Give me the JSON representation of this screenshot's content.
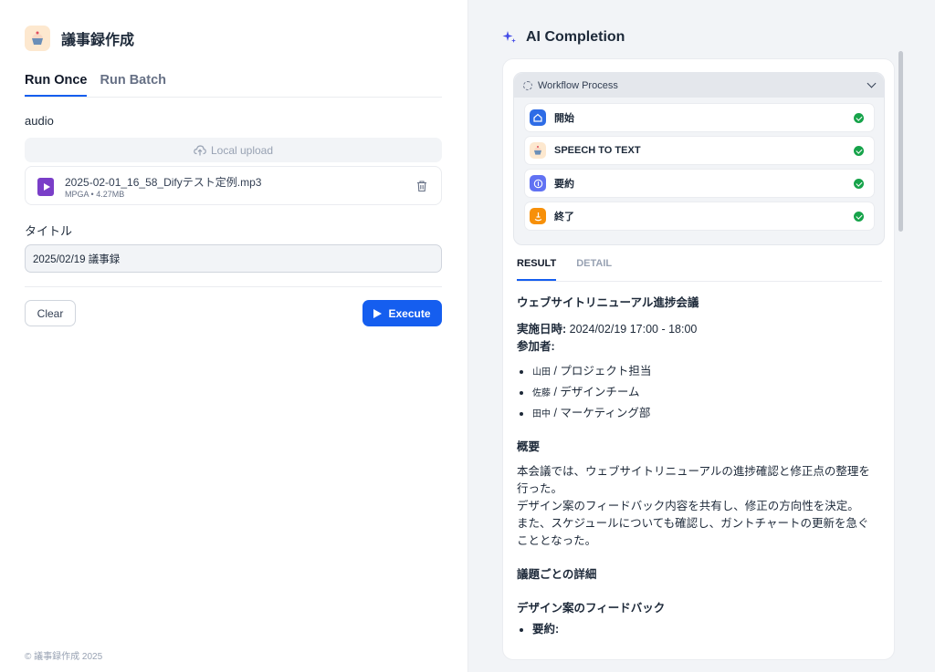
{
  "left": {
    "app_title": "議事録作成",
    "app_icon": "cupcake-icon",
    "tabs": [
      {
        "label": "Run Once",
        "active": true
      },
      {
        "label": "Run Batch",
        "active": false
      }
    ],
    "audio_label": "audio",
    "upload_label": "Local upload",
    "file": {
      "name": "2025-02-01_16_58_Difyテスト定例.mp3",
      "type": "MPGA",
      "size": "4.27MB",
      "separator": "•"
    },
    "title_label": "タイトル",
    "title_value": "2025/02/19 議事録",
    "clear_label": "Clear",
    "execute_label": "Execute",
    "footer": "© 議事録作成 2025"
  },
  "right": {
    "title": "AI Completion",
    "workflow": {
      "header": "Workflow Process",
      "nodes": [
        {
          "label": "開始",
          "icon": "home-icon",
          "color": "#2e6ce6",
          "status": "success"
        },
        {
          "label": "SPEECH TO TEXT",
          "icon": "cupcake-icon",
          "color": "#fde8cf",
          "status": "success"
        },
        {
          "label": "要約",
          "icon": "llm-icon",
          "color": "#6172f3",
          "status": "success"
        },
        {
          "label": "終了",
          "icon": "end-icon",
          "color": "#f79009",
          "status": "success"
        }
      ]
    },
    "result_tabs": [
      {
        "label": "RESULT",
        "active": true
      },
      {
        "label": "DETAIL",
        "active": false
      }
    ],
    "result": {
      "meeting_title": "ウェブサイトリニューアル進捗会議",
      "date_label": "実施日時:",
      "date_value": "2024/02/19 17:00 - 18:00",
      "participants_label": "参加者:",
      "participants": [
        {
          "name": "山田",
          "role": "/ プロジェクト担当"
        },
        {
          "name": "佐藤",
          "role": "/ デザインチーム"
        },
        {
          "name": "田中",
          "role": "/ マーケティング部"
        }
      ],
      "summary_heading": "概要",
      "summary_lines": [
        "本会議では、ウェブサイトリニューアルの進捗確認と修正点の整理を",
        "行った。",
        "デザイン案のフィードバック内容を共有し、修正の方向性を決定。",
        "また、スケジュールについても確認し、ガントチャートの更新を急ぐ",
        "こととなった。"
      ],
      "details_heading": "議題ごとの詳細",
      "design_heading": "デザイン案のフィードバック",
      "design_item": "要約:"
    }
  }
}
